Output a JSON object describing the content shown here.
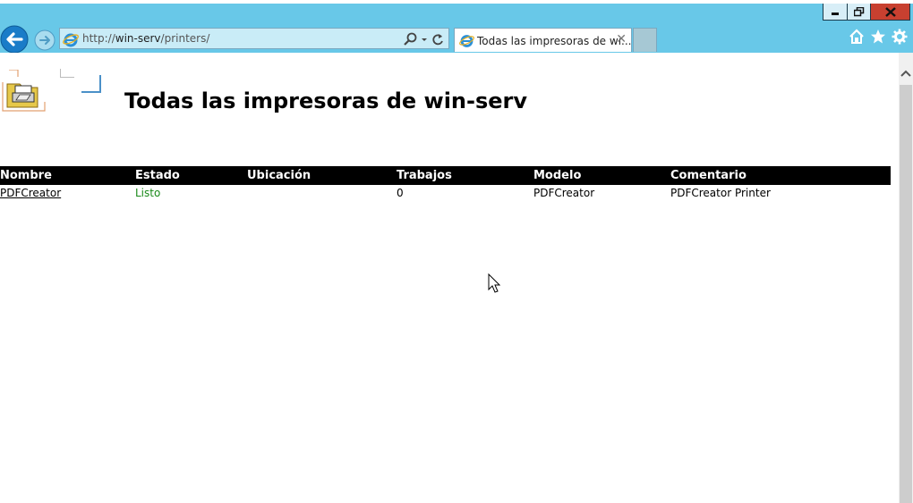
{
  "browser": {
    "address_host": "win-serv",
    "address_prefix": "http://",
    "address_path": "/printers/",
    "tab_title": "Todas las impresoras de wi...",
    "accent": "#68c8e8"
  },
  "page": {
    "title": "Todas las impresoras de win-serv"
  },
  "table": {
    "headers": [
      "Nombre",
      "Estado",
      "Ubicación",
      "Trabajos",
      "Modelo",
      "Comentario"
    ],
    "rows": [
      {
        "name": "PDFCreator",
        "status": "Listo",
        "location": "",
        "jobs": "0",
        "model": "PDFCreator",
        "comment": "PDFCreator Printer"
      }
    ]
  },
  "icons": {
    "back": "back-arrow-icon",
    "forward": "forward-arrow-icon",
    "ie": "internet-explorer-icon",
    "search": "search-icon",
    "refresh": "refresh-icon",
    "home": "home-icon",
    "favorites": "star-icon",
    "settings": "gear-icon",
    "printer": "printer-folder-icon"
  }
}
